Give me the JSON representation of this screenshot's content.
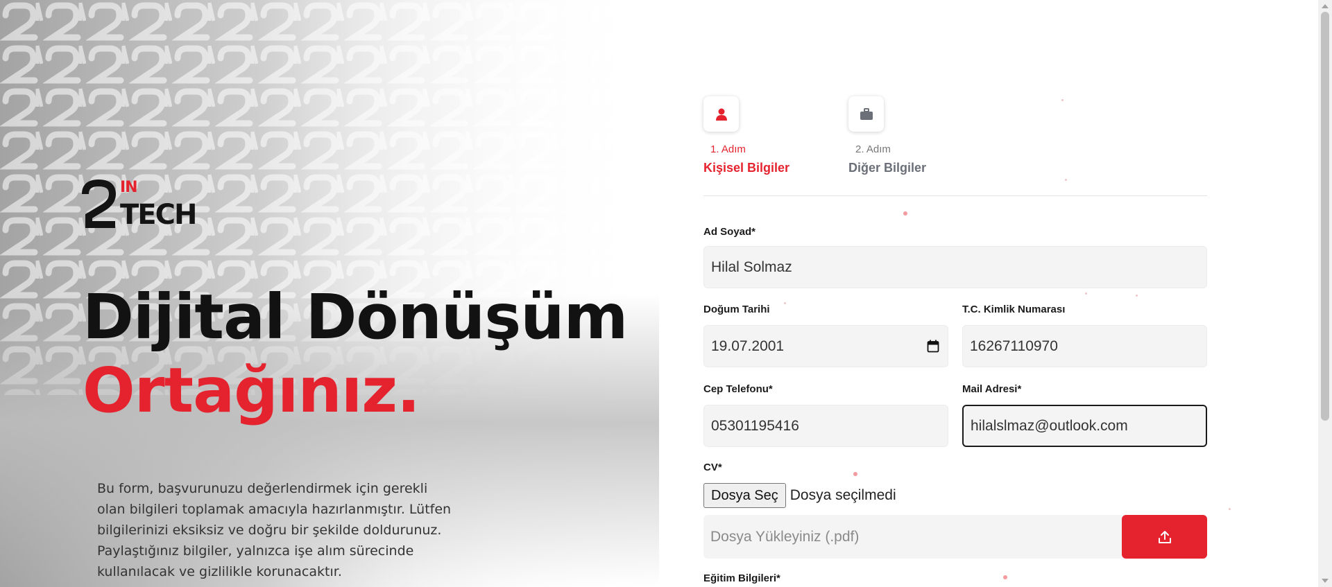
{
  "brand": {
    "logo_top": "IN",
    "logo_main": "TECH"
  },
  "hero": {
    "headline_line1": "Dijital Dönüşüm",
    "headline_line2": "Ortağınız.",
    "intro_text": "Bu form, başvurunuzu değerlendirmek için gerekli olan bilgileri toplamak amacıyla hazırlanmıştır. Lütfen bilgilerinizi eksiksiz ve doğru bir şekilde doldurunuz. Paylaştığınız bilgiler, yalnızca işe alım sürecinde kullanılacak ve gizlilikle korunacaktır."
  },
  "steps": [
    {
      "number": "1. Adım",
      "title": "Kişisel Bilgiler",
      "icon": "user-icon",
      "active": true
    },
    {
      "number": "2. Adım",
      "title": "Diğer Bilgiler",
      "icon": "briefcase-icon",
      "active": false
    }
  ],
  "form": {
    "full_name": {
      "label": "Ad Soyad*",
      "value": "Hilal Solmaz"
    },
    "birth_date": {
      "label": "Doğum Tarihi",
      "value": "19.07.2001"
    },
    "tc_number": {
      "label": "T.C. Kimlik Numarası",
      "value": "16267110970"
    },
    "phone": {
      "label": "Cep Telefonu*",
      "value": "05301195416"
    },
    "email": {
      "label": "Mail Adresi*",
      "value": "hilalslmaz@outlook.com"
    },
    "cv": {
      "label": "CV*",
      "choose_button": "Dosya Seç",
      "status": "Dosya seçilmedi",
      "upload_placeholder": "Dosya Yükleyiniz (.pdf)"
    },
    "education": {
      "label": "Eğitim Bilgileri*"
    }
  },
  "colors": {
    "accent": "#e5232e",
    "text": "#121212",
    "field_bg": "#f4f4f4"
  }
}
